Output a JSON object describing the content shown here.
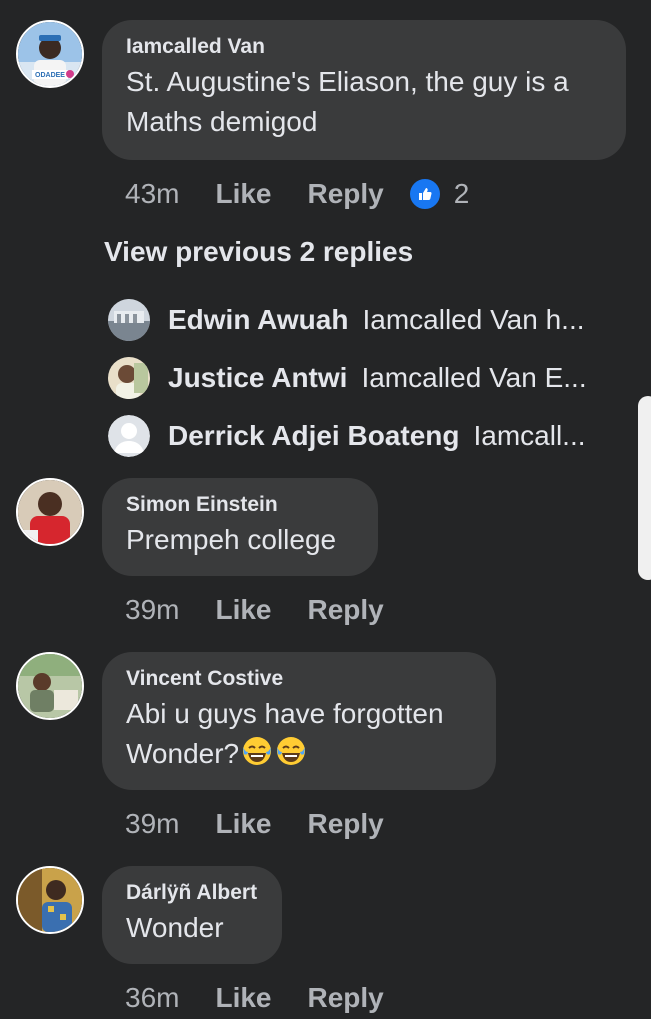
{
  "comments": [
    {
      "author": "Iamcalled Van",
      "text": "St. Augustine's Eliason, the guy is a Maths demigod",
      "time": "43m",
      "like": "Like",
      "reply": "Reply",
      "reactions": "2"
    },
    {
      "author": "Simon Einstein",
      "text": "Prempeh college",
      "time": "39m",
      "like": "Like",
      "reply": "Reply"
    },
    {
      "author": "Vincent Costive",
      "text": "Abi u guys have forgotten Wonder?",
      "time": "39m",
      "like": "Like",
      "reply": "Reply"
    },
    {
      "author": "Dárlÿñ Albert",
      "text": "Wonder",
      "time": "36m",
      "like": "Like",
      "reply": "Reply"
    }
  ],
  "view_previous": "View previous 2 replies",
  "replies": [
    {
      "name": "Edwin Awuah",
      "preview": "Iamcalled Van h..."
    },
    {
      "name": "Justice Antwi",
      "preview": "Iamcalled Van E..."
    },
    {
      "name": "Derrick Adjei Boateng",
      "preview": "Iamcall..."
    }
  ],
  "avatar_badge": "ODADEE",
  "colors": {
    "background": "#242526",
    "bubble": "#3a3b3c",
    "text": "#e4e6eb",
    "secondary_text": "#b0b3b8",
    "like_blue": "#1877f2"
  },
  "icons": {
    "reaction": "thumbs-up-icon",
    "emoji": "tears-of-joy-emoji"
  }
}
